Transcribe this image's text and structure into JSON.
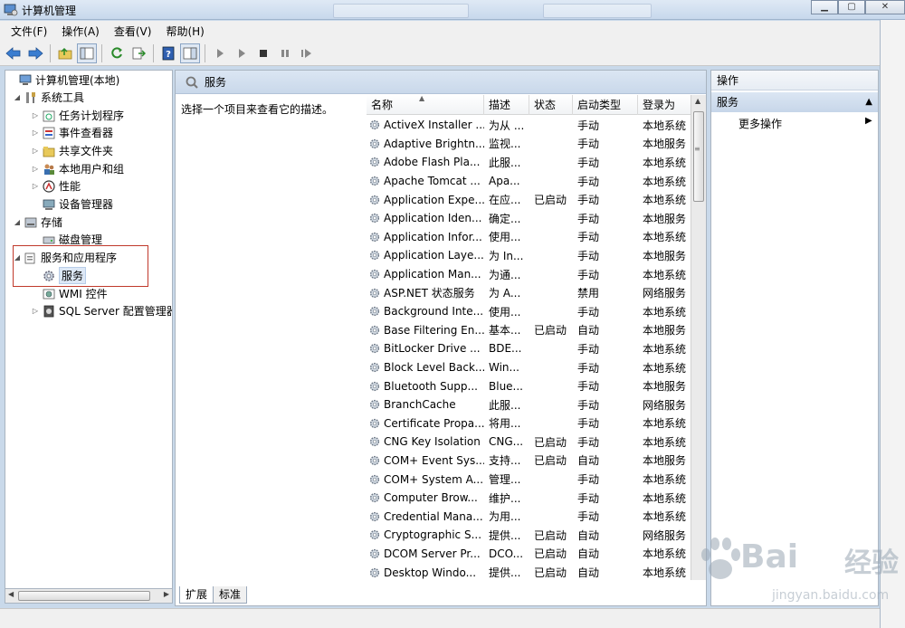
{
  "window": {
    "title": "计算机管理"
  },
  "menu": [
    "文件(F)",
    "操作(A)",
    "查看(V)",
    "帮助(H)"
  ],
  "toolbar_icons": [
    "back-arrow-icon",
    "forward-arrow-icon",
    "up-folder-icon",
    "show-hide-tree-icon",
    "refresh-icon",
    "export-list-icon",
    "help-icon",
    "properties-icon",
    "play-icon",
    "play-alt-icon",
    "stop-icon",
    "pause-icon",
    "restart-icon"
  ],
  "tree": [
    {
      "label": "计算机管理(本地)",
      "icon": "computer-icon",
      "level": 0,
      "arrow": ""
    },
    {
      "label": "系统工具",
      "icon": "tools-icon",
      "level": 1,
      "arrow": "◢"
    },
    {
      "label": "任务计划程序",
      "icon": "clock-icon",
      "level": 2,
      "arrow": "▷"
    },
    {
      "label": "事件查看器",
      "icon": "event-icon",
      "level": 2,
      "arrow": "▷"
    },
    {
      "label": "共享文件夹",
      "icon": "folder-icon",
      "level": 2,
      "arrow": "▷"
    },
    {
      "label": "本地用户和组",
      "icon": "users-icon",
      "level": 2,
      "arrow": "▷"
    },
    {
      "label": "性能",
      "icon": "performance-icon",
      "level": 2,
      "arrow": "▷"
    },
    {
      "label": "设备管理器",
      "icon": "device-icon",
      "level": 2,
      "arrow": ""
    },
    {
      "label": "存储",
      "icon": "storage-icon",
      "level": 1,
      "arrow": "◢"
    },
    {
      "label": "磁盘管理",
      "icon": "disk-icon",
      "level": 2,
      "arrow": ""
    },
    {
      "label": "服务和应用程序",
      "icon": "services-apps-icon",
      "level": 1,
      "arrow": "◢"
    },
    {
      "label": "服务",
      "icon": "gear-icon",
      "level": 2,
      "arrow": "",
      "selected": true
    },
    {
      "label": "WMI 控件",
      "icon": "wmi-icon",
      "level": 2,
      "arrow": ""
    },
    {
      "label": "SQL Server 配置管理器",
      "icon": "sql-icon",
      "level": 2,
      "arrow": "▷"
    }
  ],
  "middle": {
    "title": "服务",
    "description": "选择一个项目来查看它的描述。",
    "columns": [
      "名称",
      "描述",
      "状态",
      "启动类型",
      "登录为"
    ],
    "rows": [
      [
        "ActiveX Installer ...",
        "为从 ...",
        "",
        "手动",
        "本地系统"
      ],
      [
        "Adaptive Brightn...",
        "监视...",
        "",
        "手动",
        "本地服务"
      ],
      [
        "Adobe Flash Pla...",
        "此服...",
        "",
        "手动",
        "本地系统"
      ],
      [
        "Apache Tomcat ...",
        "Apa...",
        "",
        "手动",
        "本地系统"
      ],
      [
        "Application Expe...",
        "在应...",
        "已启动",
        "手动",
        "本地系统"
      ],
      [
        "Application Iden...",
        "确定...",
        "",
        "手动",
        "本地服务"
      ],
      [
        "Application Infor...",
        "使用...",
        "",
        "手动",
        "本地系统"
      ],
      [
        "Application Laye...",
        "为 In...",
        "",
        "手动",
        "本地服务"
      ],
      [
        "Application Man...",
        "为通...",
        "",
        "手动",
        "本地系统"
      ],
      [
        "ASP.NET 状态服务",
        "为 A...",
        "",
        "禁用",
        "网络服务"
      ],
      [
        "Background Inte...",
        "使用...",
        "",
        "手动",
        "本地系统"
      ],
      [
        "Base Filtering En...",
        "基本...",
        "已启动",
        "自动",
        "本地服务"
      ],
      [
        "BitLocker Drive ...",
        "BDE...",
        "",
        "手动",
        "本地系统"
      ],
      [
        "Block Level Back...",
        "Win...",
        "",
        "手动",
        "本地系统"
      ],
      [
        "Bluetooth Supp...",
        "Blue...",
        "",
        "手动",
        "本地服务"
      ],
      [
        "BranchCache",
        "此服...",
        "",
        "手动",
        "网络服务"
      ],
      [
        "Certificate Propa...",
        "将用...",
        "",
        "手动",
        "本地系统"
      ],
      [
        "CNG Key Isolation",
        "CNG...",
        "已启动",
        "手动",
        "本地系统"
      ],
      [
        "COM+ Event Sys...",
        "支持...",
        "已启动",
        "自动",
        "本地服务"
      ],
      [
        "COM+ System A...",
        "管理...",
        "",
        "手动",
        "本地系统"
      ],
      [
        "Computer Brow...",
        "维护...",
        "",
        "手动",
        "本地系统"
      ],
      [
        "Credential Mana...",
        "为用...",
        "",
        "手动",
        "本地系统"
      ],
      [
        "Cryptographic S...",
        "提供...",
        "已启动",
        "自动",
        "网络服务"
      ],
      [
        "DCOM Server Pr...",
        "DCO...",
        "已启动",
        "自动",
        "本地系统"
      ],
      [
        "Desktop Windo...",
        "提供...",
        "已启动",
        "自动",
        "本地系统"
      ]
    ],
    "tabs": [
      "扩展",
      "标准"
    ]
  },
  "actions": {
    "title": "操作",
    "group": "服务",
    "item": "更多操作"
  },
  "watermark": {
    "logo": "Bai",
    "logo_cn": "经验",
    "url": "jingyan.baidu.com"
  },
  "colors": {
    "titlebar": "#c7d8ec",
    "selection": "#dde8f6",
    "highlight_box": "#c0392b"
  }
}
